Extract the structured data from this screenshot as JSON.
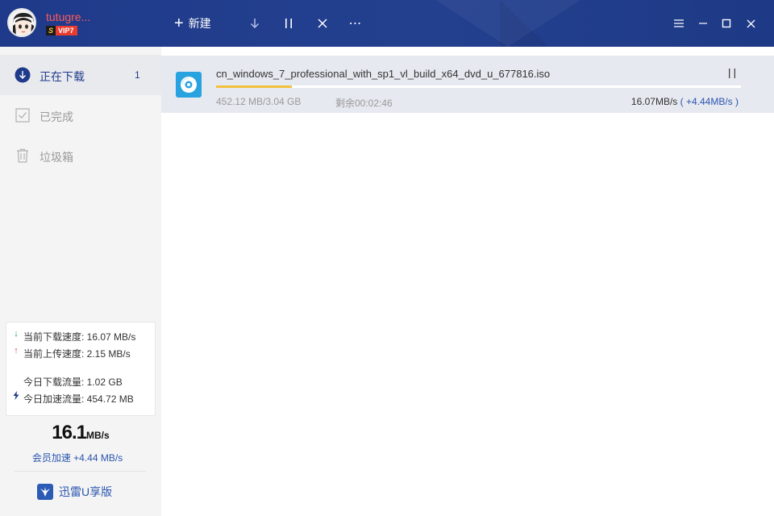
{
  "user": {
    "name": "tutugre...",
    "vip_badge": "VIP7",
    "vip_s": "S"
  },
  "toolbar": {
    "new_label": "新建",
    "more_label": "⋯"
  },
  "colors": {
    "titlebar": "#1f3a8a",
    "accent": "#2a55b0",
    "progress": "#f3c13c",
    "disc_icon": "#29a3e0",
    "username": "#ff5a5a"
  },
  "sidebar": {
    "items": [
      {
        "label": "正在下载",
        "count": "1",
        "icon": "download-circle-icon"
      },
      {
        "label": "已完成",
        "icon": "checkbox-icon"
      },
      {
        "label": "垃圾箱",
        "icon": "trash-icon"
      }
    ],
    "stats": {
      "down_speed": "当前下载速度: 16.07 MB/s",
      "up_speed": "当前上传速度: 2.15 MB/s",
      "today_down": "今日下载流量: 1.02 GB",
      "today_accel": "今日加速流量: 454.72 MB"
    },
    "big_speed": {
      "value": "16.1",
      "unit": "MB/s"
    },
    "vip_accel": "会员加速 +4.44 MB/s",
    "u_edition": "迅雷U享版"
  },
  "downloads": [
    {
      "filename": "cn_windows_7_professional_with_sp1_vl_build_x64_dvd_u_677816.iso",
      "size": "452.12 MB/3.04 GB",
      "remaining": "剩余00:02:46",
      "speed": "16.07MB/s",
      "extra_speed": "( +4.44MB/s )",
      "progress": 0.145
    }
  ]
}
